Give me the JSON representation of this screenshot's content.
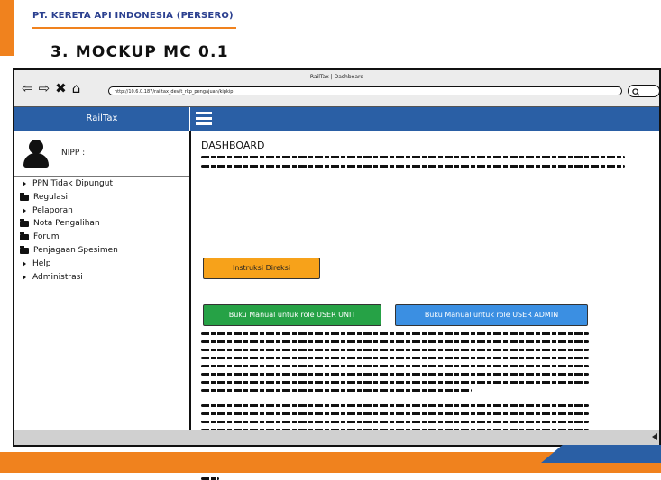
{
  "slide": {
    "company": "PT. KERETA API INDONESIA (PERSERO)",
    "title": "3. MOCKUP MC 0.1"
  },
  "browser": {
    "window_title": "RailTax | Dashboard",
    "url": "http://10.6.0.187/railtax_dev/t_rkp_pengajuan/kipkip",
    "search_icon": "search-icon"
  },
  "app": {
    "brand": "RailTax",
    "user_label": "NIPP :",
    "menu": [
      {
        "label": "PPN Tidak Dipungut",
        "icon": "triangle"
      },
      {
        "label": "Regulasi",
        "icon": "folder"
      },
      {
        "label": "Pelaporan",
        "icon": "triangle"
      },
      {
        "label": "Nota Pengalihan",
        "icon": "folder"
      },
      {
        "label": "Forum",
        "icon": "folder"
      },
      {
        "label": "Penjagaan Spesimen",
        "icon": "folder"
      },
      {
        "label": "Help",
        "icon": "triangle"
      },
      {
        "label": "Administrasi",
        "icon": "triangle"
      }
    ]
  },
  "main": {
    "title": "DASHBOARD",
    "buttons": {
      "instruksi": "Instruksi Direksi",
      "manual_unit": "Buku Manual untuk role USER UNIT",
      "manual_admin": "Buku Manual untuk role USER ADMIN"
    }
  },
  "colors": {
    "accent_orange": "#f0821e",
    "brand_blue": "#2a5fa5",
    "button_orange": "#f7a21a",
    "button_green": "#26a246",
    "button_blue": "#3b8fe2"
  }
}
